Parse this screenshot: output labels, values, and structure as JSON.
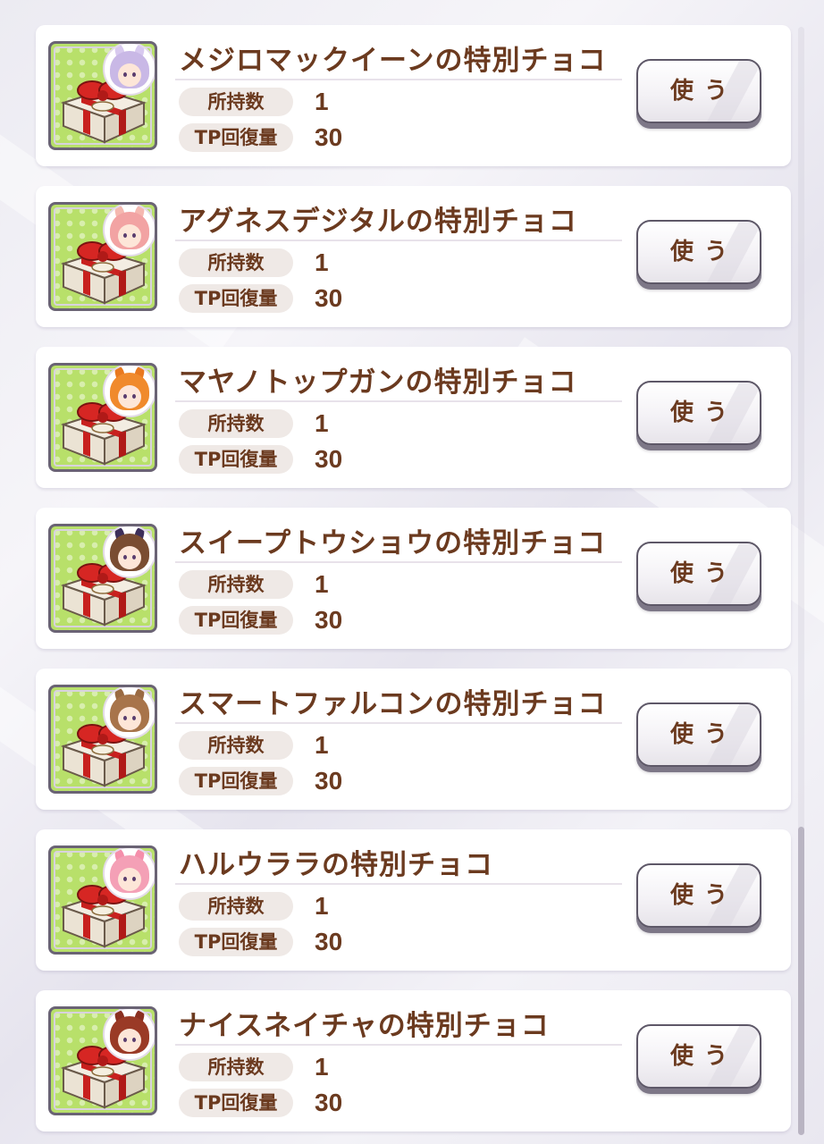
{
  "items": [
    {
      "name": "メジロマックイーンの特別チョコ",
      "count_label": "所持数",
      "count": "1",
      "tp_label": "TP回復量",
      "tp": "30",
      "button_label": "使う",
      "character_colors": {
        "hair": "#c9b8e6",
        "ear": "#d8c9ef"
      }
    },
    {
      "name": "アグネスデジタルの特別チョコ",
      "count_label": "所持数",
      "count": "1",
      "tp_label": "TP回復量",
      "tp": "30",
      "button_label": "使う",
      "character_colors": {
        "hair": "#f2a3a3",
        "ear": "#f5b8b0"
      }
    },
    {
      "name": "マヤノトップガンの特別チョコ",
      "count_label": "所持数",
      "count": "1",
      "tp_label": "TP回復量",
      "tp": "30",
      "button_label": "使う",
      "character_colors": {
        "hair": "#f08a2c",
        "ear": "#e9791f"
      }
    },
    {
      "name": "スイープトウショウの特別チョコ",
      "count_label": "所持数",
      "count": "1",
      "tp_label": "TP回復量",
      "tp": "30",
      "button_label": "使う",
      "character_colors": {
        "hair": "#7a4d32",
        "ear": "#3d2f5a"
      }
    },
    {
      "name": "スマートファルコンの特別チョコ",
      "count_label": "所持数",
      "count": "1",
      "tp_label": "TP回復量",
      "tp": "30",
      "button_label": "使う",
      "character_colors": {
        "hair": "#a8744a",
        "ear": "#9a6a42"
      }
    },
    {
      "name": "ハルウララの特別チョコ",
      "count_label": "所持数",
      "count": "1",
      "tp_label": "TP回復量",
      "tp": "30",
      "button_label": "使う",
      "character_colors": {
        "hair": "#f4a0b6",
        "ear": "#f58fab"
      }
    },
    {
      "name": "ナイスネイチャの特別チョコ",
      "count_label": "所持数",
      "count": "1",
      "tp_label": "TP回復量",
      "tp": "30",
      "button_label": "使う",
      "character_colors": {
        "hair": "#9a3a26",
        "ear": "#8a2f20"
      }
    }
  ],
  "icons": {
    "item_icon": "gift-box-icon",
    "character_badge": "character-portrait-icon"
  },
  "colors": {
    "text_brown": "#6b3a1f",
    "icon_bg_green": "#b8e06a",
    "ribbon_red": "#c8201e"
  }
}
